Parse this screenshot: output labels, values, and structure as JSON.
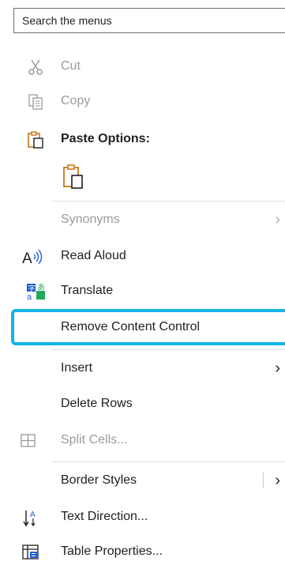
{
  "search": {
    "placeholder": "Search the menus"
  },
  "menu": {
    "cut": {
      "label": "Cut",
      "icon": "scissors-icon"
    },
    "copy": {
      "label": "Copy",
      "icon": "copy-icon"
    },
    "paste_options": {
      "label": "Paste Options:",
      "icon": "clipboard-icon"
    },
    "paste_keep": {
      "icon": "paste-keep-text-only-icon"
    },
    "synonyms": {
      "label": "Synonyms"
    },
    "read_aloud": {
      "label": "Read Aloud",
      "icon": "read-aloud-icon"
    },
    "translate": {
      "label": "Translate",
      "icon": "translate-icon"
    },
    "remove_content_control": {
      "label": "Remove Content Control"
    },
    "insert": {
      "label": "Insert"
    },
    "delete_rows": {
      "label": "Delete Rows"
    },
    "split_cells": {
      "label": "Split Cells...",
      "icon": "split-cells-icon"
    },
    "border_styles": {
      "label": "Border Styles"
    },
    "text_direction": {
      "label": "Text Direction...",
      "icon": "text-direction-icon"
    },
    "table_properties": {
      "label": "Table Properties...",
      "icon": "table-properties-icon"
    }
  },
  "colors": {
    "highlight": "#14b4e6",
    "accent_orange": "#c8781e",
    "disabled": "#9a9a9a"
  }
}
